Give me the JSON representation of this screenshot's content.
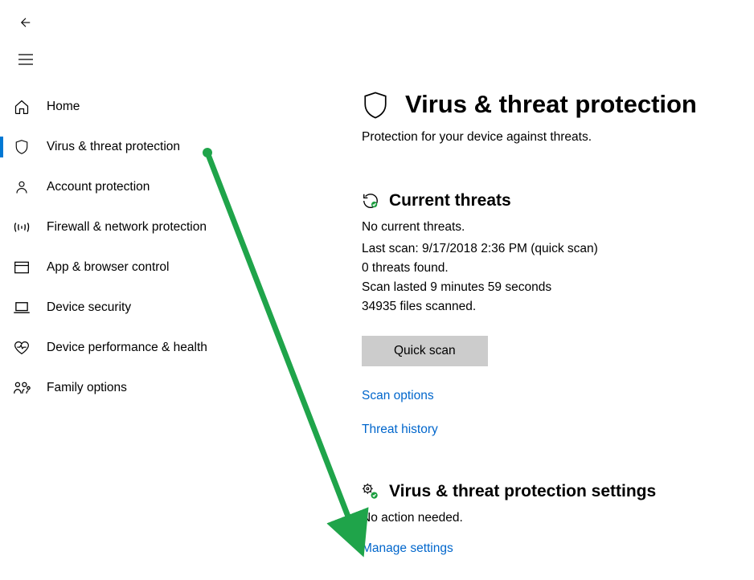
{
  "sidebar": {
    "items": [
      {
        "label": "Home"
      },
      {
        "label": "Virus & threat protection"
      },
      {
        "label": "Account protection"
      },
      {
        "label": "Firewall & network protection"
      },
      {
        "label": "App & browser control"
      },
      {
        "label": "Device security"
      },
      {
        "label": "Device performance & health"
      },
      {
        "label": "Family options"
      }
    ]
  },
  "page": {
    "title": "Virus & threat protection",
    "subtitle": "Protection for your device against threats."
  },
  "current_threats": {
    "heading": "Current threats",
    "status": "No current threats.",
    "last_scan": "Last scan: 9/17/2018 2:36 PM (quick scan)",
    "threats_found": "0 threats found.",
    "scan_duration": "Scan lasted 9 minutes 59 seconds",
    "files_scanned": "34935 files scanned.",
    "button": "Quick scan",
    "link_options": "Scan options",
    "link_history": "Threat history"
  },
  "settings": {
    "heading": "Virus & threat protection settings",
    "status": "No action needed.",
    "link": "Manage settings"
  }
}
